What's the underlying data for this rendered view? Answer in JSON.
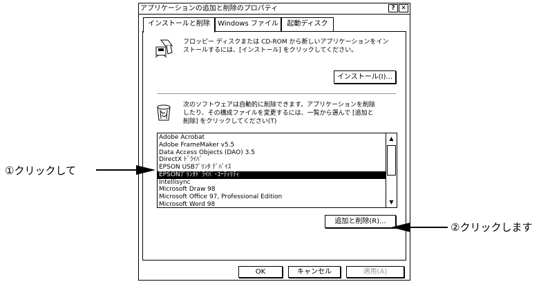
{
  "window": {
    "title": "アプリケーションの追加と削除のプロパティ",
    "help_label": "?",
    "close_label": "✕"
  },
  "tabs": [
    {
      "label": "インストールと削除",
      "active": true
    },
    {
      "label": "Windows ファイル",
      "active": false
    },
    {
      "label": "起動ディスク",
      "active": false
    }
  ],
  "install": {
    "description_line1": "フロッピー ディスクまたは CD-ROM から新しいアプリケーションをイン",
    "description_line2": "ストールするには、[インストール] をクリックしてください。",
    "button_label": "インストール(I)..."
  },
  "remove": {
    "description_line1": "次のソフトウェアは自動的に削除できます。アプリケーションを削除",
    "description_line2": "したり、その構成ファイルを変更するには、一覧から選んで [追加と",
    "description_line3": "削除] をクリックしてください(T)"
  },
  "programs": [
    "Adobe Acrobat",
    "Adobe FrameMaker v5.5",
    "Data Access Objects (DAO) 3.5",
    "DirectX ﾄﾞﾗｲﾊﾞ",
    "EPSON USBﾌﾟﾘﾝﾀ ﾃﾞﾊﾞｲｽ",
    "EPSONﾌﾟﾘﾝﾀﾄﾞﾗｲﾊﾞ･ﾕｰﾃｨﾘﾃｨ",
    "Intellisync",
    "Microsoft Draw 98",
    "Microsoft Office 97, Professional Edition",
    "Microsoft Word 98"
  ],
  "selected_index": 5,
  "add_remove_button": "追加と削除(R)...",
  "footer": {
    "ok": "OK",
    "cancel": "キャンセル",
    "apply": "適用(A)"
  },
  "callouts": {
    "left": "①クリックして",
    "right": "②クリックします"
  }
}
